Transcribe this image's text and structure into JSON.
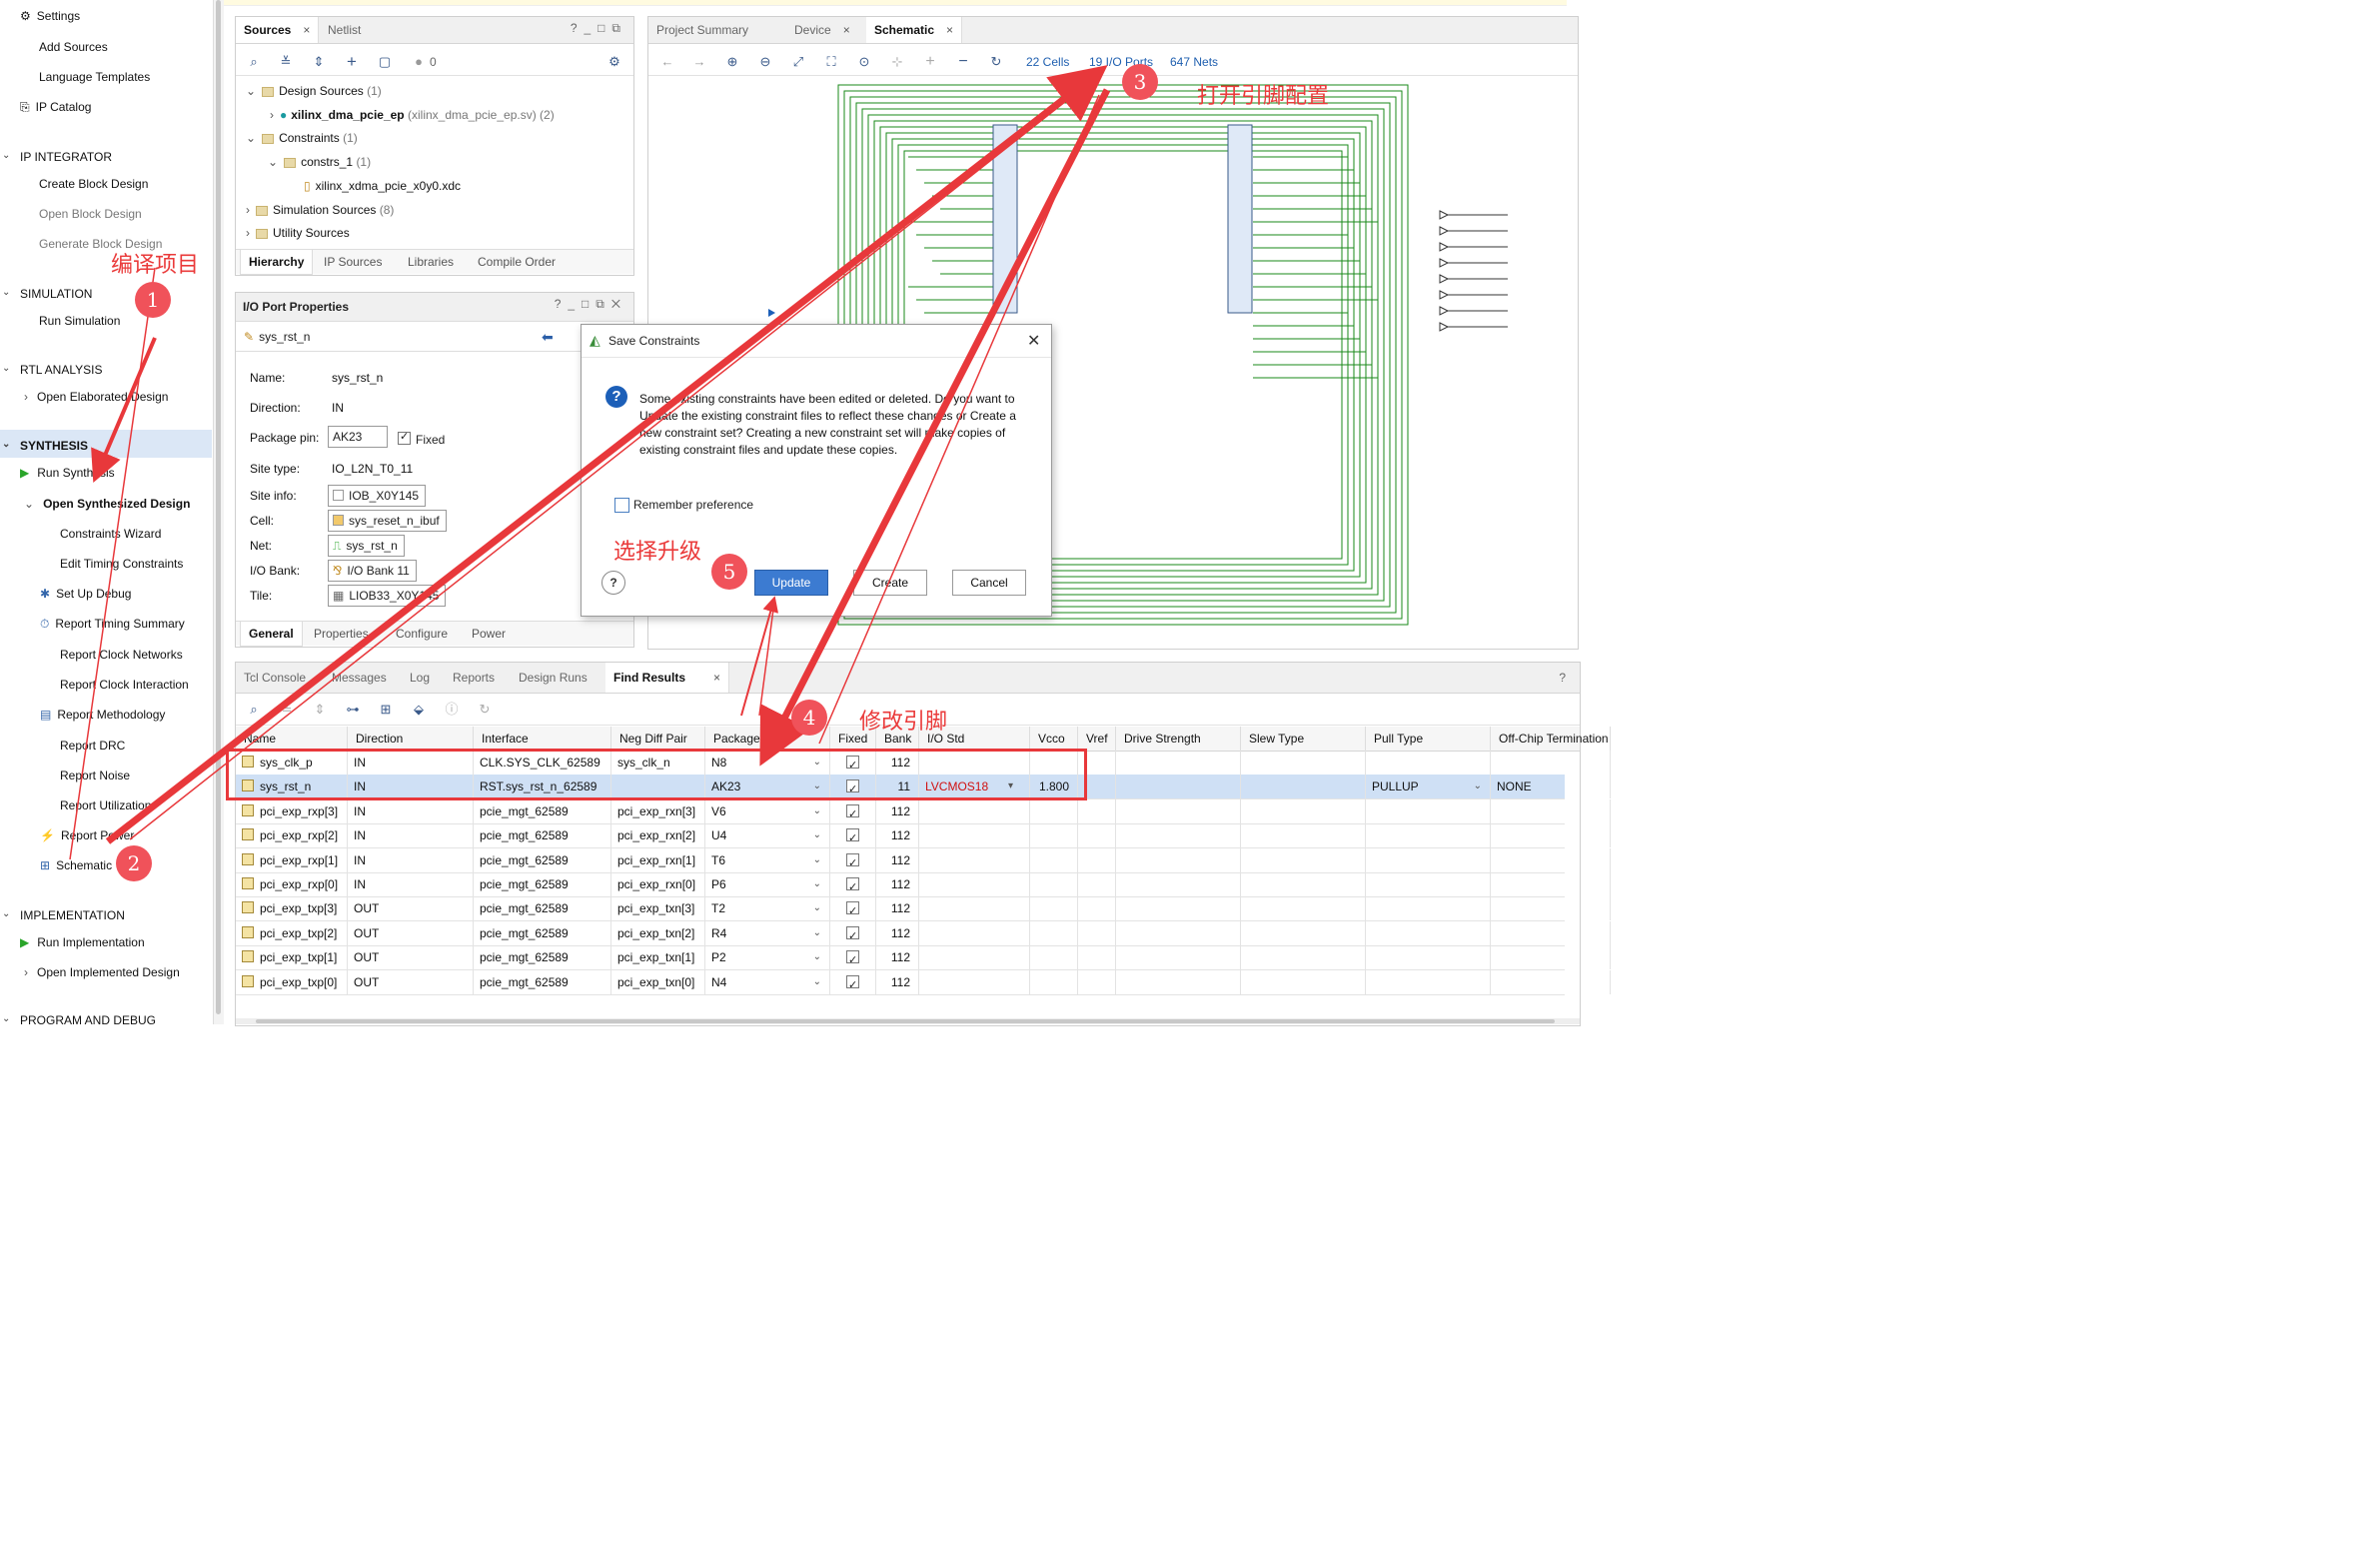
{
  "flow_navigator": {
    "items": [
      {
        "label": "Settings",
        "icon": "gear-icon"
      },
      {
        "label": "Add Sources"
      },
      {
        "label": "Language Templates"
      },
      {
        "label": "IP Catalog",
        "icon": "ip-catalog-icon"
      }
    ],
    "sections": {
      "ip_integrator": {
        "title": "IP INTEGRATOR",
        "items": [
          "Create Block Design",
          "Open Block Design",
          "Generate Block Design"
        ]
      },
      "simulation": {
        "title": "SIMULATION",
        "items": [
          "Run Simulation"
        ]
      },
      "rtl": {
        "title": "RTL ANALYSIS",
        "items": [
          "Open Elaborated Design"
        ]
      },
      "synthesis": {
        "title": "SYNTHESIS",
        "items": [
          "Run Synthesis",
          "Open Synthesized Design",
          "Constraints Wizard",
          "Edit Timing Constraints",
          "Set Up Debug",
          "Report Timing Summary",
          "Report Clock Networks",
          "Report Clock Interaction",
          "Report Methodology",
          "Report DRC",
          "Report Noise",
          "Report Utilization",
          "Report Power",
          "Schematic"
        ]
      },
      "implementation": {
        "title": "IMPLEMENTATION",
        "items": [
          "Run Implementation",
          "Open Implemented Design"
        ]
      },
      "program": {
        "title": "PROGRAM AND DEBUG"
      }
    }
  },
  "sources": {
    "tabs": [
      "Sources",
      "Netlist"
    ],
    "badge": "0",
    "tree": [
      {
        "label": "Design Sources",
        "count": "(1)"
      },
      {
        "label": "xilinx_dma_pcie_ep",
        "detail": "(xilinx_dma_pcie_ep.sv) (2)"
      },
      {
        "label": "Constraints",
        "count": "(1)"
      },
      {
        "label": "constrs_1",
        "count": "(1)"
      },
      {
        "label": "xilinx_xdma_pcie_x0y0.xdc"
      },
      {
        "label": "Simulation Sources",
        "count": "(8)"
      },
      {
        "label": "Utility Sources"
      }
    ],
    "subtabs": [
      "Hierarchy",
      "IP Sources",
      "Libraries",
      "Compile Order"
    ]
  },
  "io_props": {
    "title": "I/O Port Properties",
    "port": "sys_rst_n",
    "name_label": "Name:",
    "name": "sys_rst_n",
    "direction_label": "Direction:",
    "direction": "IN",
    "pin_label": "Package pin:",
    "pin": "AK23",
    "fixed_label": "Fixed",
    "site_type_label": "Site type:",
    "site_type": "IO_L2N_T0_11",
    "site_info_label": "Site info:",
    "site_info": "IOB_X0Y145",
    "cell_label": "Cell:",
    "cell": "sys_reset_n_ibuf",
    "net_label": "Net:",
    "net": "sys_rst_n",
    "bank_label": "I/O Bank:",
    "bank": "I/O Bank 11",
    "tile_label": "Tile:",
    "tile": "LIOB33_X0Y145",
    "subtabs": [
      "General",
      "Properties",
      "Configure",
      "Power"
    ]
  },
  "schematic": {
    "tabs": [
      "Project Summary",
      "Device",
      "Schematic"
    ],
    "cells": "22 Cells",
    "ports": "19 I/O Ports",
    "nets": "647 Nets"
  },
  "dialog": {
    "title": "Save Constraints",
    "message": "Some existing constraints have been edited or deleted. Do you want to Update the existing constraint files to reflect these changes or Create a new constraint set? Creating a new constraint set will make copies of existing constraint files and update these copies.",
    "remember": "Remember preference",
    "update": "Update",
    "create": "Create",
    "cancel": "Cancel"
  },
  "console": {
    "tabs": [
      "Tcl Console",
      "Messages",
      "Log",
      "Reports",
      "Design Runs",
      "Find Results"
    ],
    "columns": [
      "Name",
      "Direction",
      "Interface",
      "Neg Diff Pair",
      "Package Pin",
      "Fixed",
      "Bank",
      "I/O Std",
      "Vcco",
      "Vref",
      "Drive Strength",
      "Slew Type",
      "Pull Type",
      "Off-Chip Termination"
    ],
    "rows": [
      {
        "name": "sys_clk_p",
        "dir": "IN",
        "iface": "CLK.SYS_CLK_62589",
        "neg": "sys_clk_n",
        "pin": "N8",
        "bank": "112",
        "iostd": "",
        "vcco": "",
        "pull": "",
        "term": ""
      },
      {
        "name": "sys_rst_n",
        "dir": "IN",
        "iface": "RST.sys_rst_n_62589",
        "neg": "",
        "pin": "AK23",
        "bank": "11",
        "iostd": "LVCMOS18",
        "vcco": "1.800",
        "pull": "PULLUP",
        "term": "NONE"
      },
      {
        "name": "pci_exp_rxp[3]",
        "dir": "IN",
        "iface": "pcie_mgt_62589",
        "neg": "pci_exp_rxn[3]",
        "pin": "V6",
        "bank": "112",
        "iostd": "",
        "vcco": "",
        "pull": "",
        "term": ""
      },
      {
        "name": "pci_exp_rxp[2]",
        "dir": "IN",
        "iface": "pcie_mgt_62589",
        "neg": "pci_exp_rxn[2]",
        "pin": "U4",
        "bank": "112",
        "iostd": "",
        "vcco": "",
        "pull": "",
        "term": ""
      },
      {
        "name": "pci_exp_rxp[1]",
        "dir": "IN",
        "iface": "pcie_mgt_62589",
        "neg": "pci_exp_rxn[1]",
        "pin": "T6",
        "bank": "112",
        "iostd": "",
        "vcco": "",
        "pull": "",
        "term": ""
      },
      {
        "name": "pci_exp_rxp[0]",
        "dir": "IN",
        "iface": "pcie_mgt_62589",
        "neg": "pci_exp_rxn[0]",
        "pin": "P6",
        "bank": "112",
        "iostd": "",
        "vcco": "",
        "pull": "",
        "term": ""
      },
      {
        "name": "pci_exp_txp[3]",
        "dir": "OUT",
        "iface": "pcie_mgt_62589",
        "neg": "pci_exp_txn[3]",
        "pin": "T2",
        "bank": "112",
        "iostd": "",
        "vcco": "",
        "pull": "",
        "term": ""
      },
      {
        "name": "pci_exp_txp[2]",
        "dir": "OUT",
        "iface": "pcie_mgt_62589",
        "neg": "pci_exp_txn[2]",
        "pin": "R4",
        "bank": "112",
        "iostd": "",
        "vcco": "",
        "pull": "",
        "term": ""
      },
      {
        "name": "pci_exp_txp[1]",
        "dir": "OUT",
        "iface": "pcie_mgt_62589",
        "neg": "pci_exp_txn[1]",
        "pin": "P2",
        "bank": "112",
        "iostd": "",
        "vcco": "",
        "pull": "",
        "term": ""
      },
      {
        "name": "pci_exp_txp[0]",
        "dir": "OUT",
        "iface": "pcie_mgt_62589",
        "neg": "pci_exp_txn[0]",
        "pin": "N4",
        "bank": "112",
        "iostd": "",
        "vcco": "",
        "pull": "",
        "term": ""
      }
    ]
  },
  "annotations": {
    "step1": "1",
    "step2": "2",
    "step3": "3",
    "step4": "4",
    "step5": "5",
    "compile": "编译项目",
    "open_pins": "打开引脚配置",
    "modify_pins": "修改引脚",
    "choose_update": "选择升级"
  },
  "colors": {
    "accent": "#3c7bd1",
    "annotation": "#e8383b",
    "selection": "#cfe0f5",
    "schematic_wire": "#1a8a1a"
  }
}
